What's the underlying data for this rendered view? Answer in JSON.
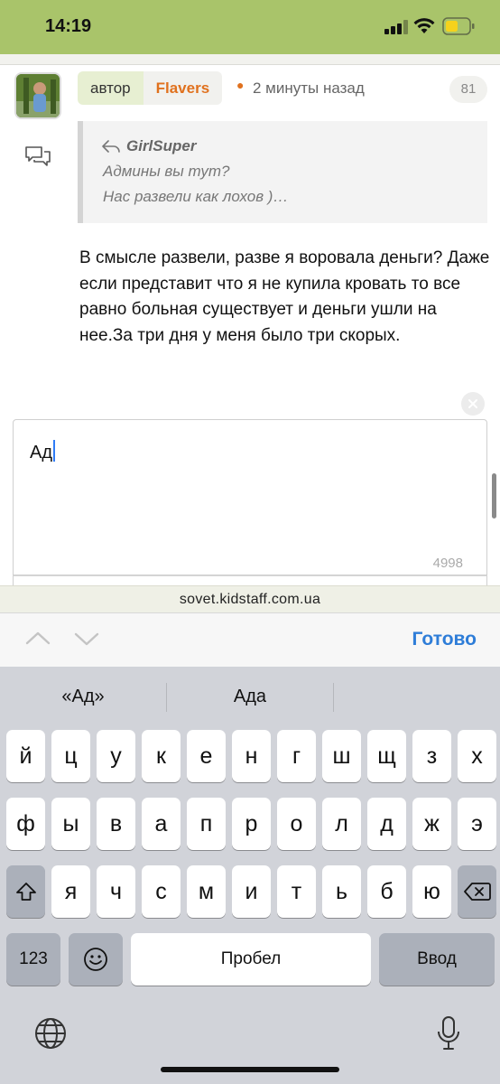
{
  "status_bar": {
    "time": "14:19",
    "icons": [
      "signal-icon",
      "wifi-icon",
      "battery-icon"
    ],
    "background": "#a9c46a"
  },
  "post": {
    "author_label": "автор",
    "author_name": "Flavers",
    "timestamp": "2 минуты назад",
    "post_number": "81",
    "quote": {
      "author": "GirlSuper",
      "lines": [
        "Админы вы тут?",
        "Нас развели как лохов )…"
      ]
    },
    "text": "В смысле развели, разве я воровала деньги? Даже если представит что я не купила кровать то все равно больная существует и деньги ушли на нее.За три дня у меня было три скорых."
  },
  "editor": {
    "value": "Ад",
    "char_count": "4998"
  },
  "browser": {
    "url": "sovet.kidstaff.com.ua"
  },
  "accessory": {
    "done_label": "Готово",
    "accent": "#2e7dd8"
  },
  "keyboard": {
    "suggestions": [
      "«Ад»",
      "Ада",
      ""
    ],
    "row1": [
      "й",
      "ц",
      "у",
      "к",
      "е",
      "н",
      "г",
      "ш",
      "щ",
      "з",
      "х"
    ],
    "row2": [
      "ф",
      "ы",
      "в",
      "а",
      "п",
      "р",
      "о",
      "л",
      "д",
      "ж",
      "э"
    ],
    "row3": [
      "я",
      "ч",
      "с",
      "м",
      "и",
      "т",
      "ь",
      "б",
      "ю"
    ],
    "numbers_label": "123",
    "space_label": "Пробел",
    "return_label": "Ввод"
  }
}
